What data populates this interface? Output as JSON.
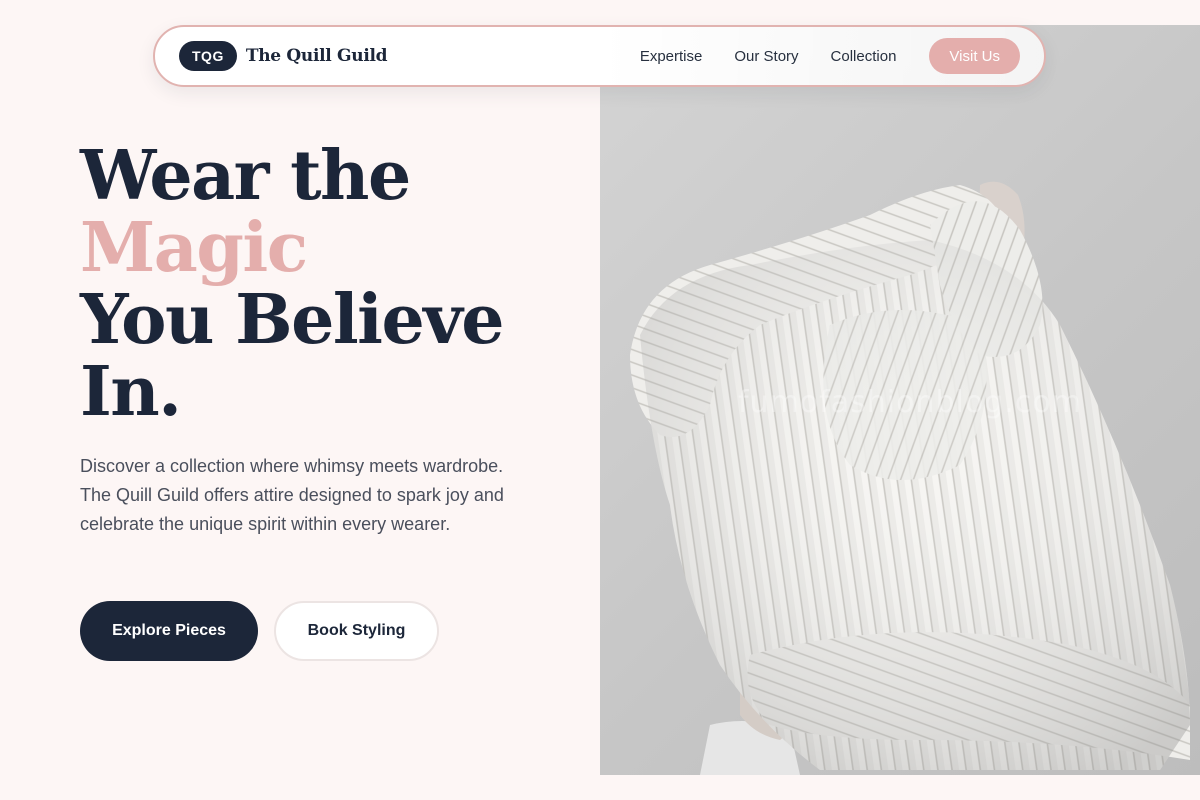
{
  "nav": {
    "logo_badge": "TQG",
    "brand_name": "The Quill Guild",
    "links": [
      {
        "label": "Expertise"
      },
      {
        "label": "Our Story"
      },
      {
        "label": "Collection"
      }
    ],
    "cta_label": "Visit Us"
  },
  "hero": {
    "title_line1": "Wear the",
    "title_accent": "Magic",
    "title_line3": "You Believe",
    "title_line4": "In.",
    "description": "Discover a collection where whimsy meets wardrobe. The Quill Guild offers attire designed to spark joy and celebrate the unique spirit within every wearer.",
    "primary_button": "Explore Pieces",
    "secondary_button": "Book Styling"
  },
  "photo": {
    "watermark": "fumofashionblog.com"
  },
  "colors": {
    "navy": "#1c2639",
    "rose_accent": "#e4aeac",
    "background": "#fdf6f5",
    "nav_border": "#e1b3b0"
  }
}
